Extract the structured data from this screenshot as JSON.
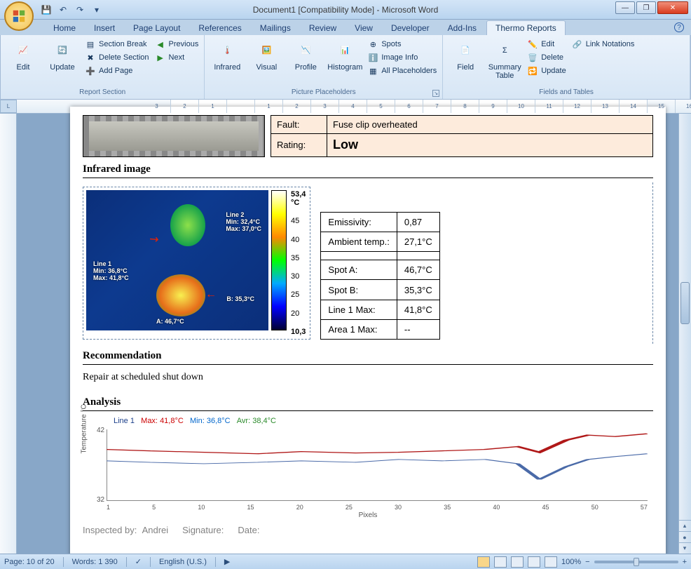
{
  "window": {
    "title": "Document1 [Compatibility Mode] - Microsoft Word"
  },
  "tabs": {
    "items": [
      "Home",
      "Insert",
      "Page Layout",
      "References",
      "Mailings",
      "Review",
      "View",
      "Developer",
      "Add-Ins",
      "Thermo Reports"
    ],
    "active": "Thermo Reports"
  },
  "ribbon": {
    "group1": {
      "label": "Report Section",
      "edit": "Edit",
      "update": "Update",
      "section_break": "Section Break",
      "delete_section": "Delete Section",
      "add_page": "Add Page",
      "previous": "Previous",
      "next": "Next"
    },
    "group2": {
      "label": "Picture Placeholders",
      "infrared": "Infrared",
      "visual": "Visual",
      "profile": "Profile",
      "histogram": "Histogram",
      "spots": "Spots",
      "image_info": "Image Info",
      "all_placeholders": "All Placeholders"
    },
    "group3": {
      "label": "Fields and Tables",
      "field": "Field",
      "summary_table": "Summary\nTable",
      "edit": "Edit",
      "delete": "Delete",
      "update": "Update",
      "link_notations": "Link Notations"
    }
  },
  "doc": {
    "fault_label": "Fault:",
    "fault_value": "Fuse clip overheated",
    "rating_label": "Rating:",
    "rating_value": "Low",
    "infrared_title": "Infrared image",
    "ir_overlay": {
      "line2_title": "Line 2",
      "line2_min": "Min: 32,4°C",
      "line2_max": "Max: 37,0°C",
      "line1_title": "Line 1",
      "line1_min": "Min: 36,8°C",
      "line1_max": "Max: 41,8°C",
      "spot_a": "A: 46,7°C",
      "spot_b": "B: 35,3°C"
    },
    "scale": {
      "max": "53,4",
      "unit": "°C",
      "t45": "45",
      "t40": "40",
      "t35": "35",
      "t30": "30",
      "t25": "25",
      "t20": "20",
      "min": "10,3"
    },
    "meas": {
      "emissivity_l": "Emissivity:",
      "emissivity_v": "0,87",
      "ambient_l": "Ambient temp.:",
      "ambient_v": "27,1°C",
      "spota_l": "Spot A:",
      "spota_v": "46,7°C",
      "spotb_l": "Spot B:",
      "spotb_v": "35,3°C",
      "line1_l": "Line 1 Max:",
      "line1_v": "41,8°C",
      "area1_l": "Area 1 Max:",
      "area1_v": "--"
    },
    "rec_title": "Recommendation",
    "rec_text": "Repair at scheduled shut down",
    "analysis_title": "Analysis",
    "chart_legend": {
      "series": "Line 1",
      "max_l": "Max:",
      "max_v": "41,8°C",
      "min_l": "Min:",
      "min_v": "36,8°C",
      "avr_l": "Avr:",
      "avr_v": "38,4°C"
    },
    "chart": {
      "ylabel": "Temperature °C",
      "xlabel": "Pixels",
      "ymax": "42",
      "ymin": "32"
    },
    "footer": {
      "inspected_l": "Inspected by:",
      "inspected_v": "Andrei",
      "signature_l": "Signature:",
      "date_l": "Date:"
    }
  },
  "chart_data": {
    "type": "line",
    "xlabel": "Pixels",
    "ylabel": "Temperature °C",
    "ylim": [
      32,
      42
    ],
    "xlim": [
      1,
      57
    ],
    "x_ticks": [
      1,
      5,
      10,
      15,
      20,
      25,
      30,
      35,
      40,
      45,
      50,
      57
    ],
    "series": [
      {
        "name": "Line 1 (Max)",
        "color": "#b01818",
        "x": [
          1,
          5,
          10,
          15,
          20,
          25,
          30,
          35,
          40,
          43,
          45,
          48,
          50,
          53,
          57
        ],
        "y": [
          39.2,
          39.0,
          38.8,
          38.6,
          38.9,
          38.7,
          38.8,
          39.0,
          39.2,
          39.6,
          38.8,
          40.5,
          41.2,
          41.0,
          41.4
        ]
      },
      {
        "name": "Line 1 (Min)",
        "color": "#4a6aa8",
        "x": [
          1,
          5,
          10,
          15,
          20,
          25,
          30,
          35,
          40,
          43,
          45,
          48,
          50,
          53,
          57
        ],
        "y": [
          37.6,
          37.4,
          37.2,
          37.4,
          37.6,
          37.4,
          37.8,
          37.6,
          37.8,
          37.2,
          35.0,
          36.8,
          37.8,
          38.2,
          38.6
        ]
      }
    ],
    "stats": {
      "max": 41.8,
      "min": 36.8,
      "avr": 38.4
    }
  },
  "status": {
    "page": "Page: 10 of 20",
    "words": "Words: 1 390",
    "lang": "English (U.S.)",
    "zoom": "100%"
  }
}
